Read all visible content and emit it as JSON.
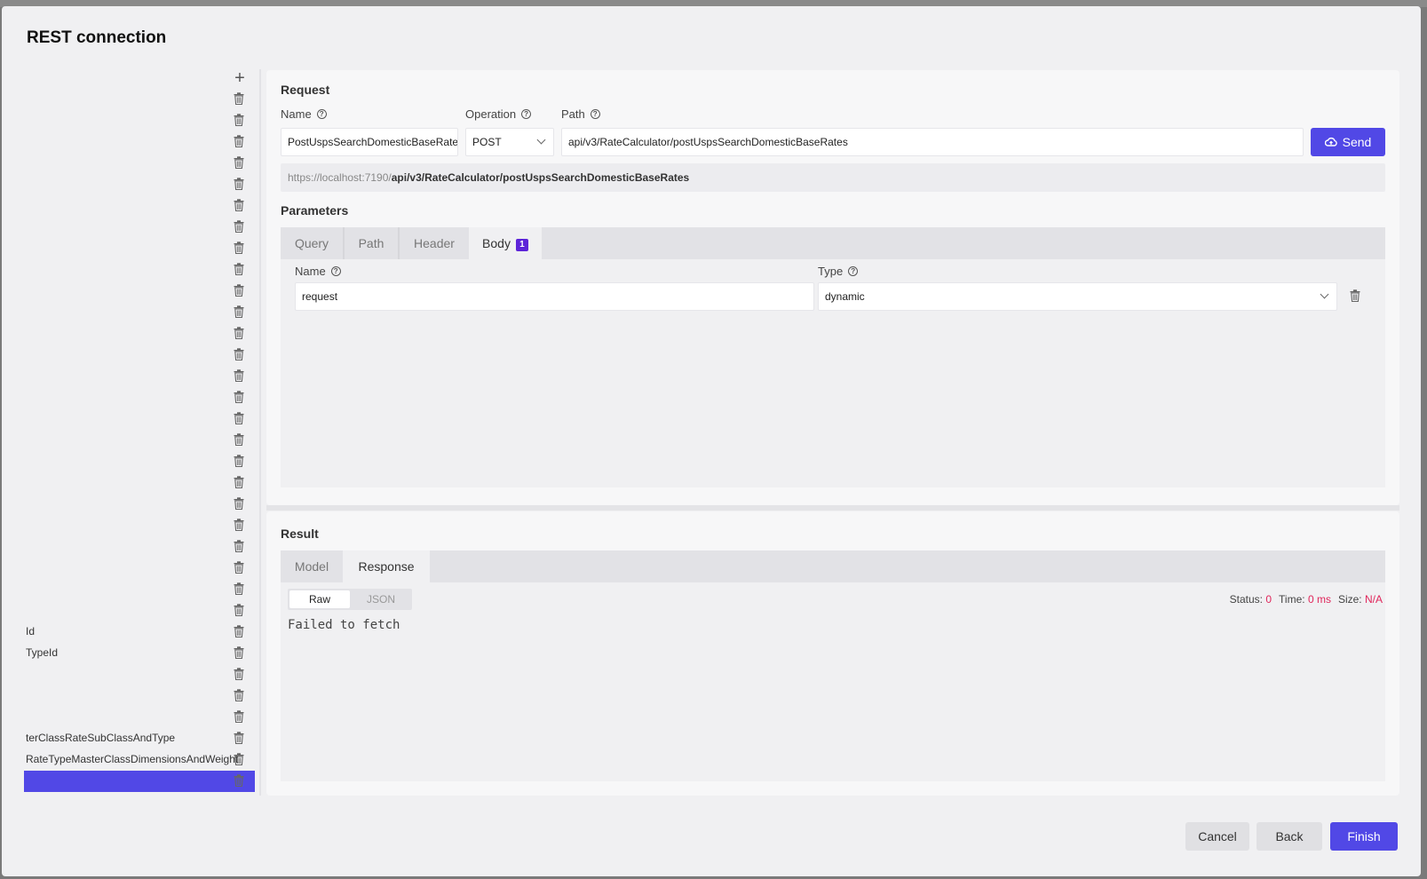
{
  "dialog": {
    "title": "REST connection"
  },
  "left_list": {
    "rows": [
      "",
      "",
      "",
      "",
      "",
      "",
      "",
      "",
      "",
      "",
      "",
      "",
      "",
      "",
      "",
      "",
      "",
      "",
      "",
      "",
      "",
      "",
      "",
      "",
      "",
      "Id",
      "TypeId",
      "",
      "",
      "",
      "terClassRateSubClassAndType",
      "RateTypeMasterClassDimensionsAndWeight",
      ""
    ],
    "selected_index": 32
  },
  "request": {
    "section_title": "Request",
    "name_label": "Name",
    "name_value": "PostUspsSearchDomesticBaseRates",
    "operation_label": "Operation",
    "operation_value": "POST",
    "path_label": "Path",
    "path_value": "api/v3/RateCalculator/postUspsSearchDomesticBaseRates",
    "send_label": "Send",
    "url_base": "https://localhost:7190/",
    "url_path": "api/v3/RateCalculator/postUspsSearchDomesticBaseRates"
  },
  "parameters": {
    "section_title": "Parameters",
    "tabs": [
      {
        "label": "Query"
      },
      {
        "label": "Path"
      },
      {
        "label": "Header"
      },
      {
        "label": "Body",
        "badge": "1"
      }
    ],
    "active_tab": "Body",
    "name_label": "Name",
    "type_label": "Type",
    "param_name": "request",
    "param_type": "dynamic"
  },
  "result": {
    "section_title": "Result",
    "tabs": [
      {
        "label": "Model"
      },
      {
        "label": "Response"
      }
    ],
    "active_tab": "Response",
    "raw_label": "Raw",
    "json_label": "JSON",
    "active_format": "Raw",
    "status_label": "Status:",
    "status_value": "0",
    "time_label": "Time:",
    "time_value": "0 ms",
    "size_label": "Size:",
    "size_value": "N/A",
    "body": "Failed to fetch"
  },
  "footer": {
    "cancel": "Cancel",
    "back": "Back",
    "finish": "Finish"
  },
  "colors": {
    "accent": "#5148e6",
    "badge": "#5d24d8",
    "status_value": "#e0265b"
  }
}
